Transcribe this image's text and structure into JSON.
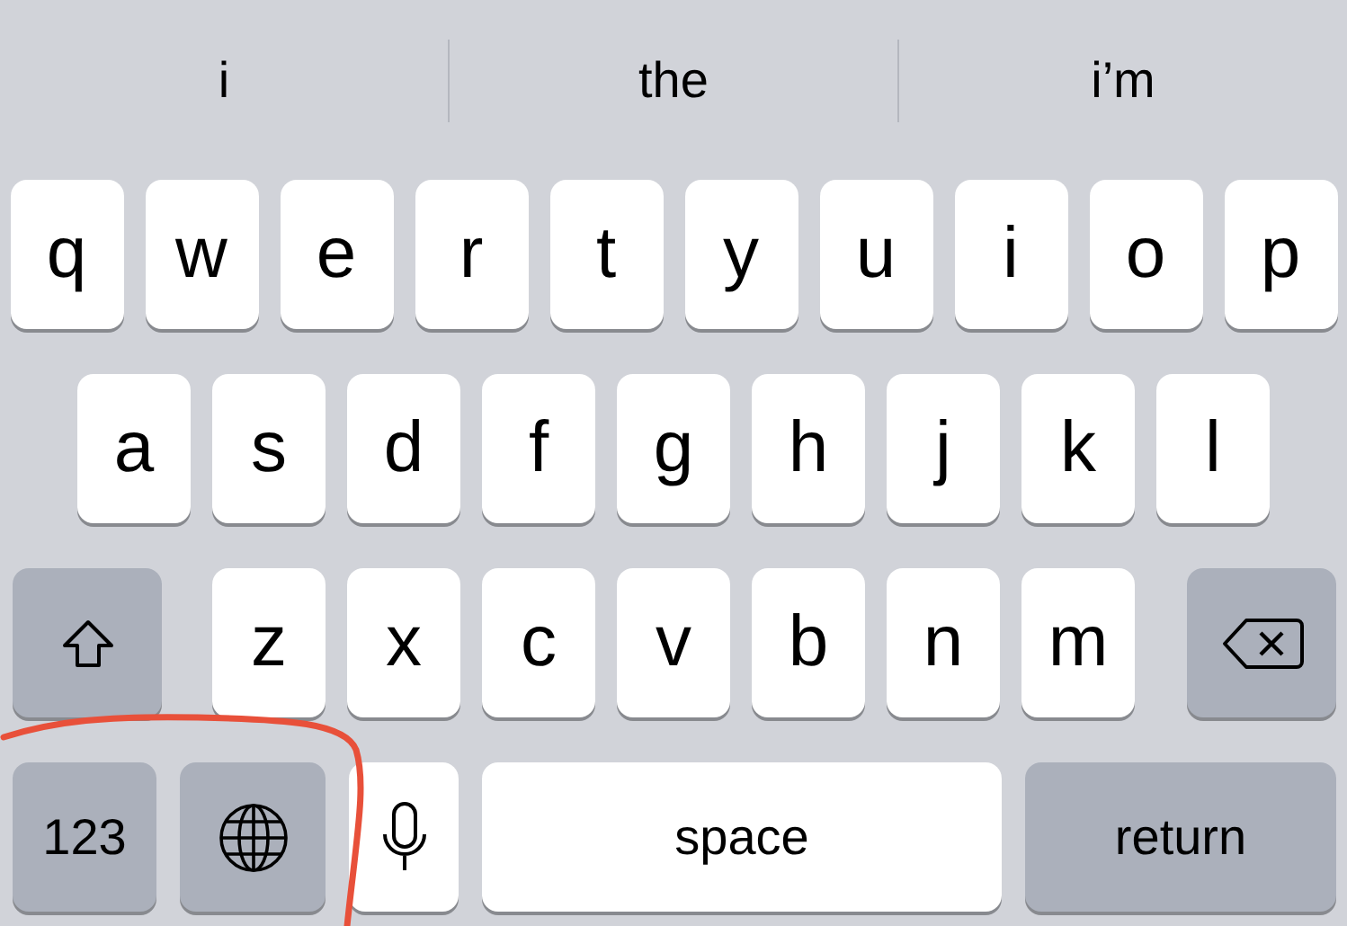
{
  "suggestions": [
    {
      "text": "i"
    },
    {
      "text": "the"
    },
    {
      "text": "i’m"
    }
  ],
  "rows": [
    [
      {
        "kind": "letter",
        "label": "q"
      },
      {
        "kind": "letter",
        "label": "w"
      },
      {
        "kind": "letter",
        "label": "e"
      },
      {
        "kind": "letter",
        "label": "r"
      },
      {
        "kind": "letter",
        "label": "t"
      },
      {
        "kind": "letter",
        "label": "y"
      },
      {
        "kind": "letter",
        "label": "u"
      },
      {
        "kind": "letter",
        "label": "i"
      },
      {
        "kind": "letter",
        "label": "o"
      },
      {
        "kind": "letter",
        "label": "p"
      }
    ],
    [
      {
        "kind": "letter",
        "label": "a"
      },
      {
        "kind": "letter",
        "label": "s"
      },
      {
        "kind": "letter",
        "label": "d"
      },
      {
        "kind": "letter",
        "label": "f"
      },
      {
        "kind": "letter",
        "label": "g"
      },
      {
        "kind": "letter",
        "label": "h"
      },
      {
        "kind": "letter",
        "label": "j"
      },
      {
        "kind": "letter",
        "label": "k"
      },
      {
        "kind": "letter",
        "label": "l"
      }
    ],
    [
      {
        "kind": "shift"
      },
      {
        "kind": "letter",
        "label": "z"
      },
      {
        "kind": "letter",
        "label": "x"
      },
      {
        "kind": "letter",
        "label": "c"
      },
      {
        "kind": "letter",
        "label": "v"
      },
      {
        "kind": "letter",
        "label": "b"
      },
      {
        "kind": "letter",
        "label": "n"
      },
      {
        "kind": "letter",
        "label": "m"
      },
      {
        "kind": "backspace"
      }
    ],
    [
      {
        "kind": "numbers",
        "label": "123"
      },
      {
        "kind": "globe"
      },
      {
        "kind": "mic"
      },
      {
        "kind": "space",
        "label": "space"
      },
      {
        "kind": "return",
        "label": "return"
      }
    ]
  ],
  "annotation": {
    "kind": "freehand-circle",
    "color": "#e8503a"
  }
}
